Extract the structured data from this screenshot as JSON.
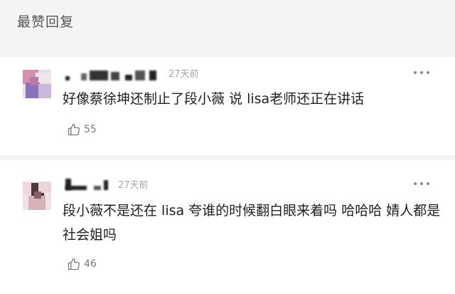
{
  "section": {
    "title": "最赞回复"
  },
  "comments": [
    {
      "time": "27天前",
      "text": "好像蔡徐坤还制止了段小薇 说 lisa老师还正在讲话",
      "likes": "55"
    },
    {
      "time": "27天前",
      "text": "段小薇不是还在 lisa 夸谁的时候翻白眼来着吗 哈哈哈 婧人都是社会姐吗",
      "likes": "46"
    }
  ],
  "icons": {
    "more": "more-dots-icon",
    "like": "thumbs-up-icon"
  },
  "colors": {
    "background": "#f4f4f4",
    "card": "#ffffff",
    "text": "#1f1f1f",
    "muted": "#a6a6a6"
  }
}
